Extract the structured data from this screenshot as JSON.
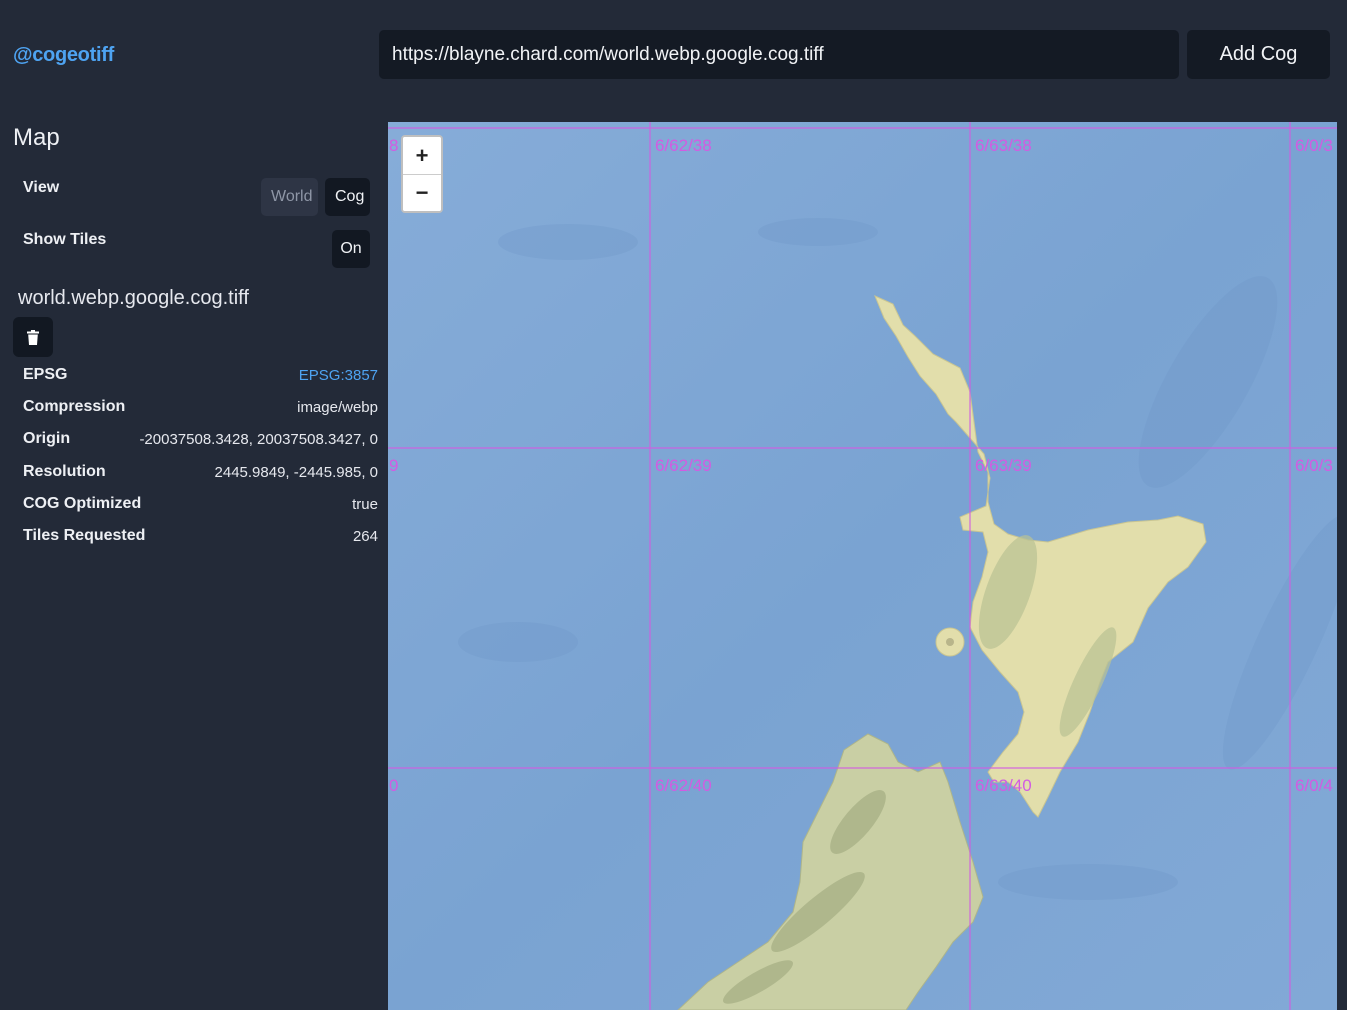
{
  "header": {
    "brand": "@cogeotiff",
    "url_value": "https://blayne.chard.com/world.webp.google.cog.tiff",
    "add_button": "Add Cog"
  },
  "sidebar": {
    "section_title": "Map",
    "view": {
      "label": "View",
      "options": [
        "World",
        "Cog"
      ],
      "selected": "Cog"
    },
    "show_tiles": {
      "label": "Show Tiles",
      "value": "On"
    },
    "file": {
      "name": "world.webp.google.cog.tiff",
      "delete_icon": "trash-icon",
      "metadata": [
        {
          "key": "EPSG",
          "value": "EPSG:3857",
          "link": true
        },
        {
          "key": "Compression",
          "value": "image/webp"
        },
        {
          "key": "Origin",
          "value": "-20037508.3428, 20037508.3427, 0"
        },
        {
          "key": "Resolution",
          "value": "2445.9849, -2445.985, 0"
        },
        {
          "key": "COG Optimized",
          "value": "true"
        },
        {
          "key": "Tiles Requested",
          "value": "264"
        }
      ]
    }
  },
  "map": {
    "zoom_in": "+",
    "zoom_out": "−",
    "tile_labels": [
      [
        "8",
        "6/62/38",
        "6/63/38",
        "6/0/3"
      ],
      [
        "9",
        "6/62/39",
        "6/63/39",
        "6/0/3"
      ],
      [
        "0",
        "6/62/40",
        "6/63/40",
        "6/0/4"
      ]
    ],
    "colors": {
      "ocean": "#7ea6d4",
      "land": "#e3dfae",
      "tile_grid": "#d25ce2"
    }
  }
}
